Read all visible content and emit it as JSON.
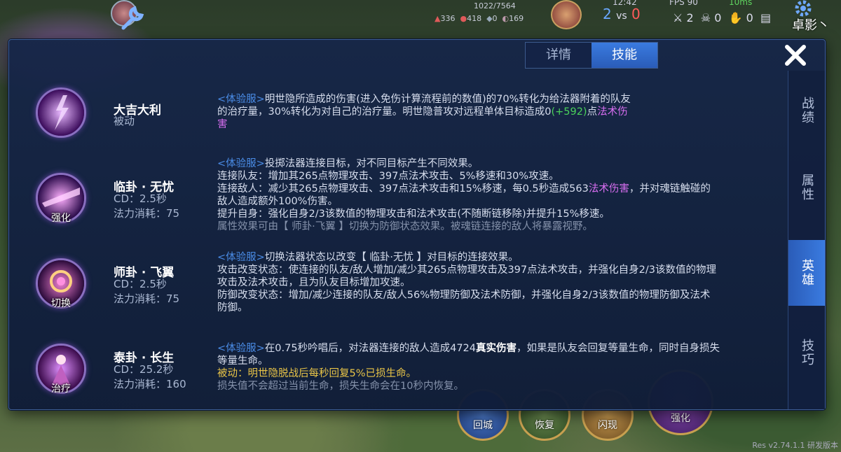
{
  "hud": {
    "top_center": "1022/7564",
    "stats": [
      "336",
      "418",
      "0",
      "169"
    ],
    "time": "12:42",
    "fps": "FPS 90",
    "ping": "10ms",
    "score_blue": "2",
    "score_vs": "vs",
    "score_red": "0",
    "kda": [
      "2",
      "0",
      "0"
    ],
    "player_name": "卓影丶",
    "bottom_skills": [
      "回城",
      "恢复",
      "闪现",
      "强化"
    ],
    "version": "Res v2.74.1.1 研发版本"
  },
  "dialog": {
    "tabs": [
      {
        "label": "详情",
        "active": false
      },
      {
        "label": "技能",
        "active": true
      }
    ],
    "side_tabs": [
      {
        "label": "战绩",
        "active": false
      },
      {
        "label": "属性",
        "active": false
      },
      {
        "label": "英雄",
        "active": true
      },
      {
        "label": "技巧",
        "active": false
      }
    ],
    "skills": [
      {
        "name": "大吉大利",
        "type": "被动",
        "icon": "lightning-figure-icon",
        "badge": "",
        "desc": [
          [
            [
              "tag",
              "<体验服>"
            ],
            [
              "",
              "明世隐所造成的伤害(进入免伤计算流程前的数值)的70%转化为给法器附着的队友"
            ]
          ],
          [
            [
              "",
              "的治疗量，30%转化为对自己的治疗量。明世隐普攻对远程单体目标造成0"
            ],
            [
              "green",
              "(+592)"
            ],
            [
              "",
              "点"
            ],
            [
              "magic",
              "法术伤"
            ]
          ],
          [
            [
              "magic",
              "害"
            ]
          ]
        ]
      },
      {
        "name": "临卦 · 无忧",
        "cd": "CD：2.5秒",
        "cost": "法力消耗：75",
        "icon": "purple-beam-icon",
        "badge": "强化",
        "desc": [
          [
            [
              "tag",
              "<体验服>"
            ],
            [
              "",
              "投掷法器连接目标，对不同目标产生不同效果。"
            ]
          ],
          [
            [
              "",
              "连接队友：增加其265点物理攻击、397点法术攻击、5%移速和30%攻速。"
            ]
          ],
          [
            [
              "",
              "连接敌人：减少其265点物理攻击、397点法术攻击和15%移速，每0.5秒造成563"
            ],
            [
              "magic",
              "法术伤害"
            ],
            [
              "",
              "，并对魂链触碰的"
            ]
          ],
          [
            [
              "",
              "敌人造成额外100%伤害。"
            ]
          ],
          [
            [
              "",
              "提升自身：强化自身2/3该数值的物理攻击和法术攻击(不随断链移除)并提升15%移速。"
            ]
          ],
          [
            [
              "dim",
              "属性效果可由【 师卦·飞翼 】切换为防御状态效果。被魂链连接的敌人将暴露视野。"
            ]
          ]
        ]
      },
      {
        "name": "师卦 · 飞翼",
        "cd": "CD：2.5秒",
        "cost": "法力消耗：75",
        "icon": "swirl-switch-icon",
        "badge": "切换",
        "desc": [
          [
            [
              "tag",
              "<体验服>"
            ],
            [
              "",
              "切换法器状态以改变【 临卦·无忧 】对目标的连接效果。"
            ]
          ],
          [
            [
              "",
              "攻击改变状态：使连接的队友/敌人增加/减少其265点物理攻击及397点法术攻击，并强化自身2/3该数值的物理"
            ]
          ],
          [
            [
              "",
              "攻击及法术攻击，且为队友目标增加攻速。"
            ]
          ],
          [
            [
              "",
              "防御改变状态：增加/减少连接的队友/敌人56%物理防御及法术防御，并强化自身2/3该数值的物理防御及法术"
            ]
          ],
          [
            [
              "",
              "防御。"
            ]
          ]
        ]
      },
      {
        "name": "泰卦 · 长生",
        "cd": "CD：25.2秒",
        "cost": "法力消耗：160",
        "icon": "heal-figure-icon",
        "badge": "治疗",
        "desc": [
          [
            [
              "tag",
              "<体验服>"
            ],
            [
              "",
              "在0.75秒吟唱后，对法器连接的敌人造成4724"
            ],
            [
              "white-b",
              "真实伤害"
            ],
            [
              "",
              "，如果是队友会回复等量生命，同时自身损失"
            ]
          ],
          [
            [
              "",
              "等量生命。"
            ]
          ],
          [
            [
              "yellow",
              "被动：明世隐脱战后每秒回复5%已损生命。"
            ]
          ],
          [
            [
              "dim",
              "损失值不会超过当前生命，损失生命会在10秒内恢复。"
            ]
          ]
        ]
      }
    ]
  }
}
